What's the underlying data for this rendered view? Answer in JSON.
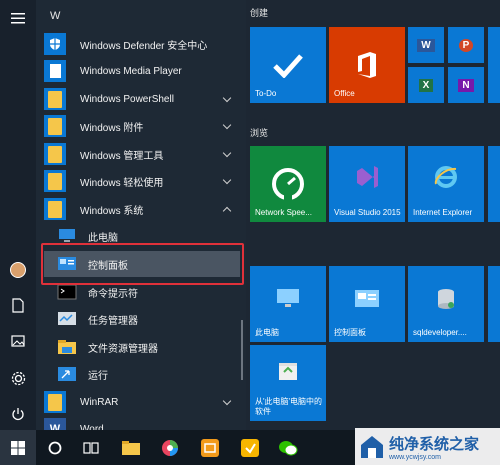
{
  "app_list": {
    "section_letter": "W",
    "items": [
      {
        "label": "Windows Defender 安全中心"
      },
      {
        "label": "Windows Media Player"
      },
      {
        "label": "Windows PowerShell"
      },
      {
        "label": "Windows 附件"
      },
      {
        "label": "Windows 管理工具"
      },
      {
        "label": "Windows 轻松使用"
      },
      {
        "label": "Windows 系统"
      },
      {
        "label": "此电脑"
      },
      {
        "label": "控制面板"
      },
      {
        "label": "命令提示符"
      },
      {
        "label": "任务管理器"
      },
      {
        "label": "文件资源管理器"
      },
      {
        "label": "运行"
      },
      {
        "label": "WinRAR"
      },
      {
        "label": "Word"
      }
    ]
  },
  "tiles": {
    "group_create": "创建",
    "group_browse": "浏览",
    "todo": "To-Do",
    "office": "Office",
    "network_speed": "Network Spee...",
    "visual_studio": "Visual Studio 2015",
    "ie": "Internet Explorer",
    "this_pc": "此电脑",
    "control_panel": "控制面板",
    "sqldeveloper": "sqldeveloper....",
    "recycle": "从'此电脑'电脑中的软件",
    "word_small": "W",
    "ppt_small": "P",
    "excel_small": "X",
    "onenote_small": "N"
  },
  "watermark": {
    "text": "纯净系统之家",
    "url": "www.ycwjsy.com"
  },
  "colors": {
    "accent": "#0a78d4",
    "office": "#d83b01",
    "highlight": "#e0313a"
  }
}
